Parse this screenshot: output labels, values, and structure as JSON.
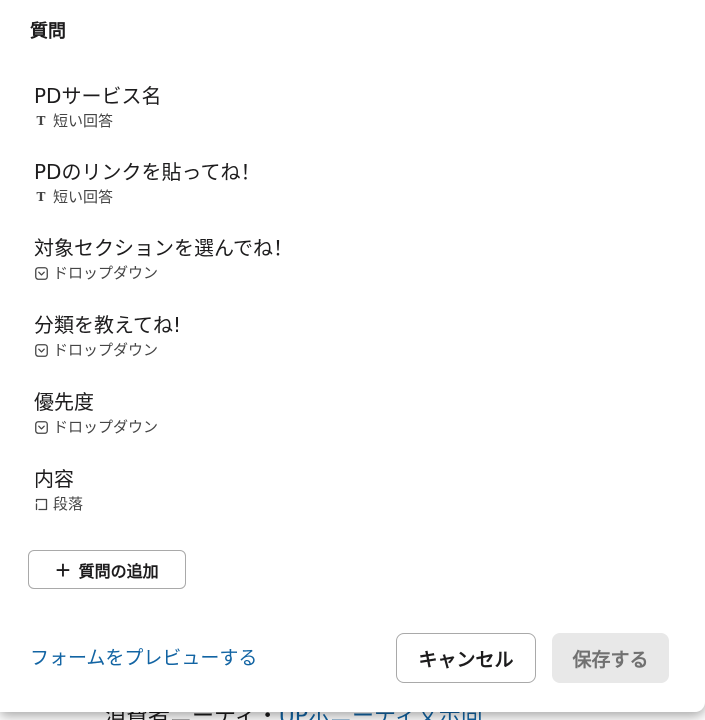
{
  "modal": {
    "section_title": "質問",
    "questions": [
      {
        "title": "PDサービス名",
        "type_label": "短い回答",
        "type_icon": "short-answer-icon"
      },
      {
        "title": "PDのリンクを貼ってね！",
        "type_label": "短い回答",
        "type_icon": "short-answer-icon"
      },
      {
        "title": "対象セクションを選んでね！",
        "type_label": "ドロップダウン",
        "type_icon": "dropdown-icon"
      },
      {
        "title": "分類を教えてね!",
        "type_label": "ドロップダウン",
        "type_icon": "dropdown-icon"
      },
      {
        "title": "優先度",
        "type_label": "ドロップダウン",
        "type_icon": "dropdown-icon"
      },
      {
        "title": "内容",
        "type_label": "段落",
        "type_icon": "paragraph-icon"
      }
    ],
    "add_question_label": "質問の追加",
    "add_question_icon": "plus-icon",
    "preview_link": "フォームをプレビューする",
    "cancel_label": "キャンセル",
    "save_label": "保存する"
  },
  "background": {
    "partial_text": "消費者ニーティ・",
    "partial_link": "UPボニーティ文示向"
  },
  "colors": {
    "link": "#1264a3",
    "save_disabled_bg": "#e8e8e8",
    "save_disabled_text": "#717171",
    "border": "#a9a9a9",
    "overlay": "#4a4a4a"
  }
}
